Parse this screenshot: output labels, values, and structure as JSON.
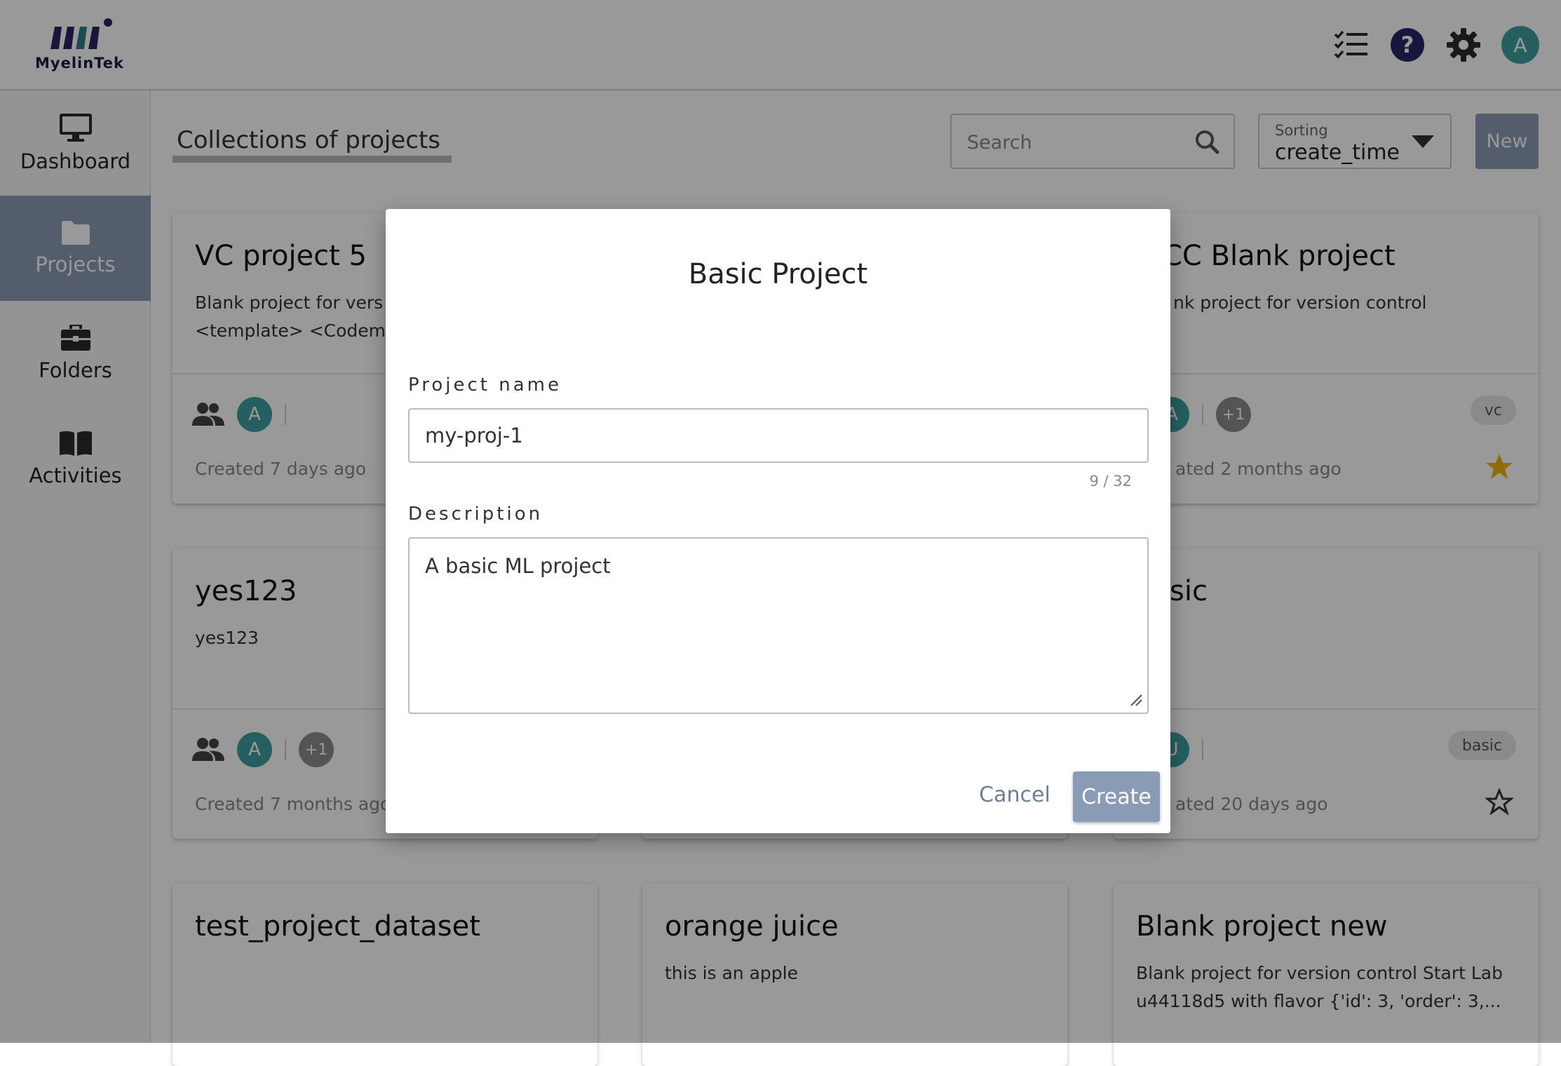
{
  "brand": {
    "logo_text": "MyelinTek"
  },
  "header": {
    "icons": [
      "tasks-icon",
      "help-icon",
      "gear-icon"
    ],
    "avatar_initial": "A"
  },
  "sidebar": {
    "items": [
      {
        "label": "Dashboard",
        "icon": "monitor-icon"
      },
      {
        "label": "Projects",
        "icon": "folder-icon",
        "active": true
      },
      {
        "label": "Folders",
        "icon": "briefcase-icon"
      },
      {
        "label": "Activities",
        "icon": "book-icon"
      }
    ]
  },
  "toolbar": {
    "title": "Collections of projects",
    "search_placeholder": "Search",
    "sorting_caption": "Sorting",
    "sorting_value": "create_time",
    "new_label": "New"
  },
  "cards": [
    {
      "title": "VC project 5",
      "description": "Blank project for vers\n<template> <Codemi",
      "created": "Created 7 days ago",
      "members": [
        "A"
      ]
    },
    {
      "title": "CC Blank project",
      "description": "nk project for version control",
      "created": "ated 2 months ago",
      "members": [
        "A",
        "+1"
      ],
      "tag": "vc",
      "starred": true
    },
    {
      "title": "yes123",
      "description": "yes123",
      "created": "Created 7 months ago",
      "members": [
        "A",
        "+1"
      ]
    },
    {
      "title": "sic",
      "description": "",
      "created": "ated 20 days ago",
      "members": [
        "U"
      ],
      "tag": "basic",
      "starred": false
    },
    {
      "title": "test_project_dataset",
      "description": ""
    },
    {
      "title": "orange juice",
      "description": "this is an apple"
    },
    {
      "title": "Blank project new",
      "description": "Blank project for version control Start Lab\nu44118d5 with flavor {'id': 3, 'order': 3,..."
    }
  ],
  "dialog": {
    "title": "Basic Project",
    "name_label": "Project name",
    "name_value": "my-proj-1",
    "name_counter": "9 / 32",
    "desc_label": "Description",
    "desc_value": "A basic ML project",
    "cancel_label": "Cancel",
    "create_label": "Create"
  },
  "colors": {
    "accent": "#8a9bb5",
    "avatar": "#3e9fa0",
    "brand": "#1d1a45",
    "star": "#f0b400"
  }
}
